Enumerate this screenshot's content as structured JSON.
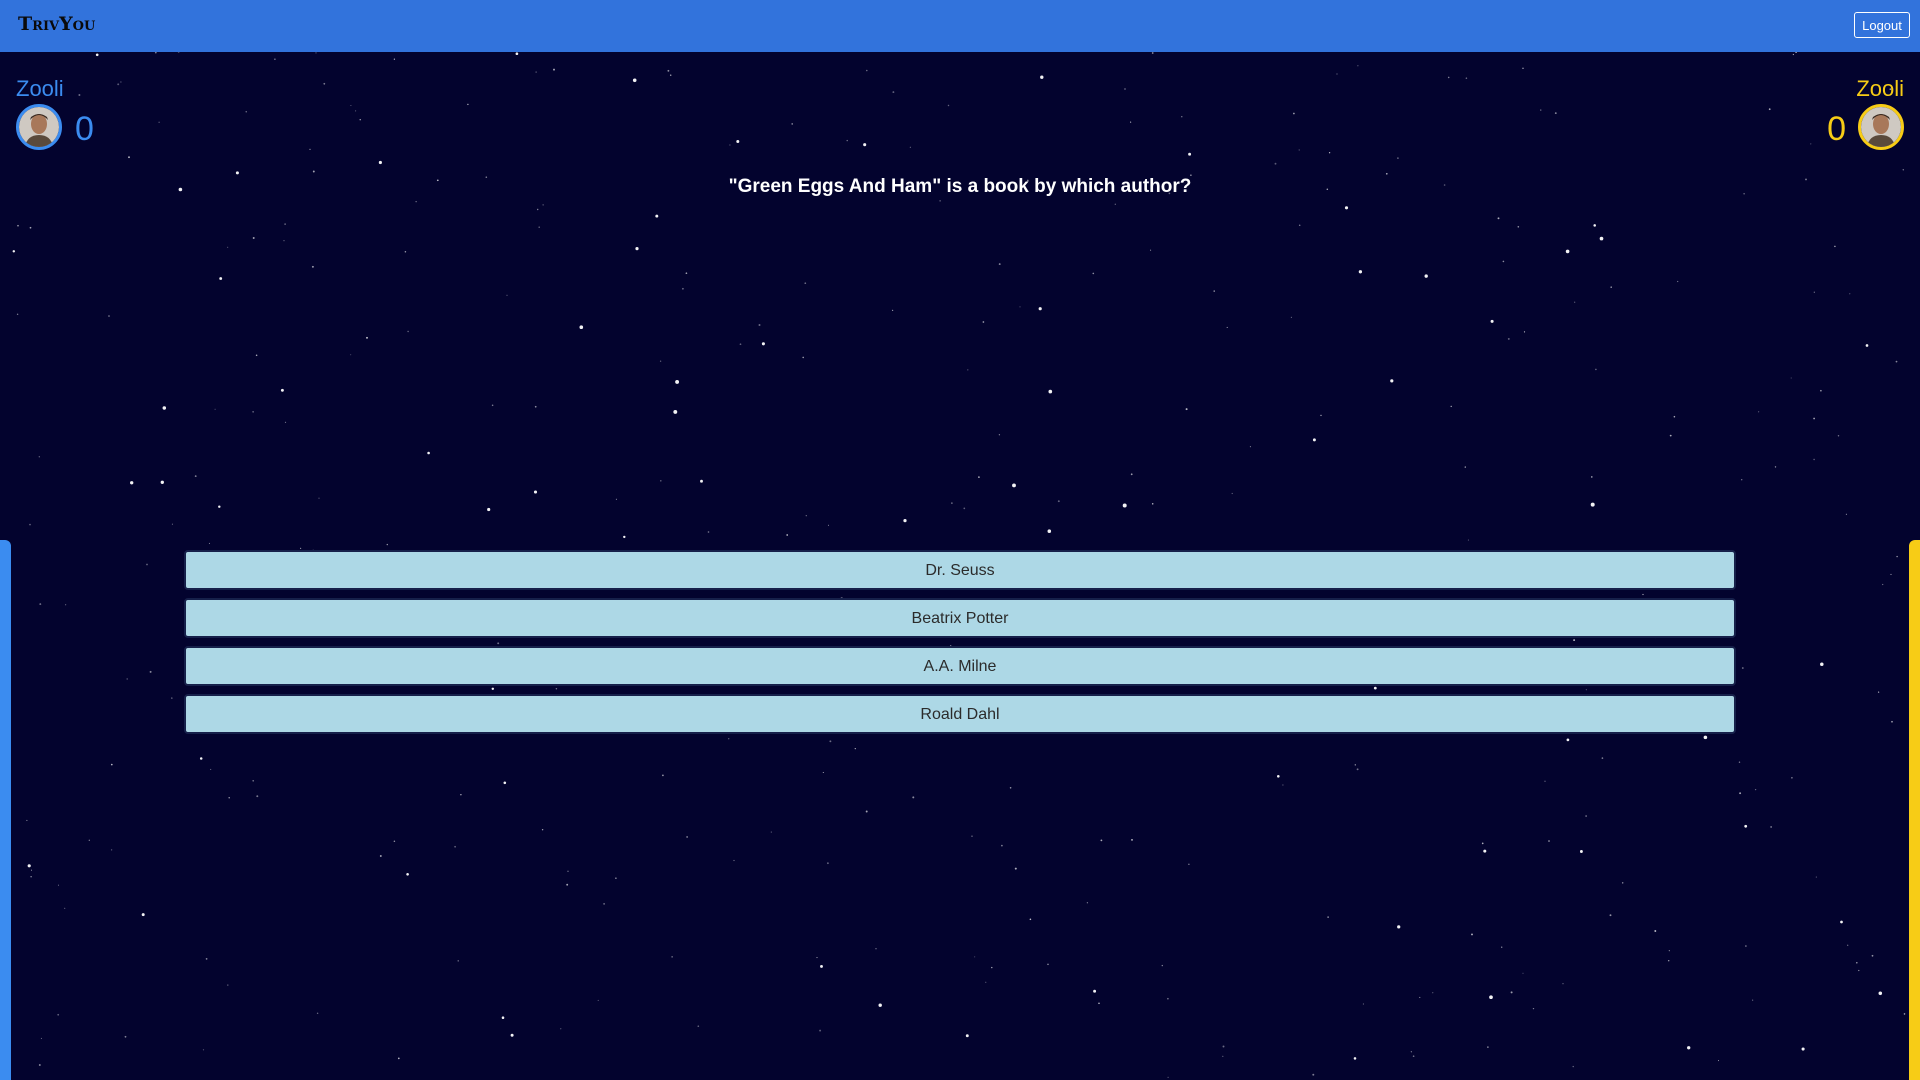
{
  "navbar": {
    "logo": "TrivYou",
    "logout_label": "Logout",
    "color": "#3273dc"
  },
  "players": {
    "left": {
      "name": "Zooli",
      "score": "0",
      "color": "#3b8cf0"
    },
    "right": {
      "name": "Zooli",
      "score": "0",
      "color": "#f7cc16"
    }
  },
  "question": "\"Green Eggs And Ham\" is a book by which author?",
  "answers": [
    "Dr. Seuss",
    "Beatrix Potter",
    "A.A. Milne",
    "Roald Dahl"
  ],
  "colors": {
    "background": "#03032e",
    "answer_bg": "#add8e6"
  }
}
